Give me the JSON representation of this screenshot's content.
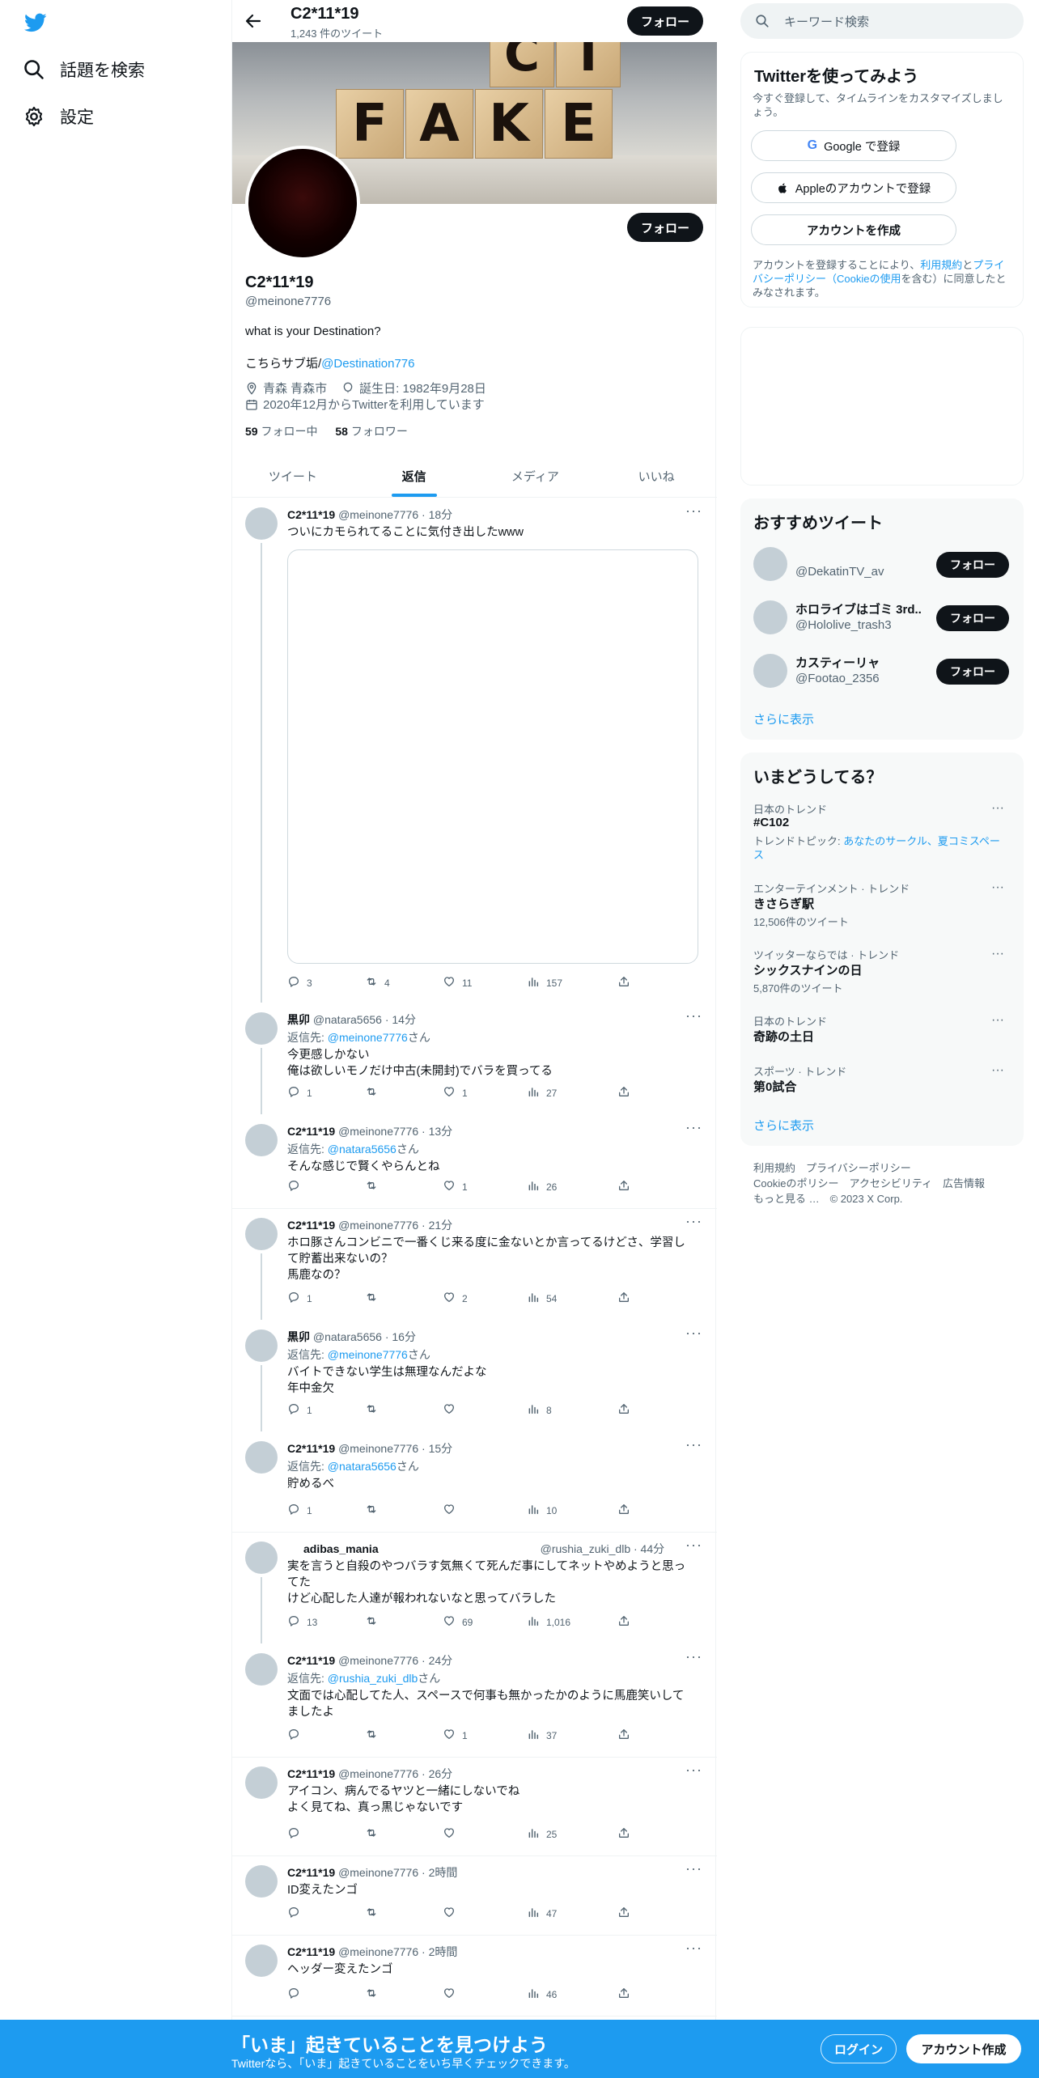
{
  "nav": {
    "explore_label": "話題を検索",
    "settings_label": "設定"
  },
  "header": {
    "title": "C2*11*19",
    "tweet_count": "1,243 件のツイート",
    "follow_label": "フォロー"
  },
  "banner": {
    "letters": [
      "F",
      "A",
      "K",
      "E",
      "C",
      "T"
    ]
  },
  "profile": {
    "name": "C2*11*19",
    "handle": "@meinone7776",
    "bio": "what is your Destination?",
    "bio2_prefix": "こちらサブ垢/",
    "bio2_link": "@Destination776",
    "location": "青森 青森市",
    "birthday": "誕生日: 1982年9月28日",
    "joined": "2020年12月からTwitterを利用しています",
    "following_count": "59",
    "following_label": "フォロー中",
    "followers_count": "58",
    "followers_label": "フォロワー",
    "follow_label": "フォロー"
  },
  "tabs": [
    "ツイート",
    "返信",
    "メディア",
    "いいね"
  ],
  "tweets": [
    {
      "name": "C2*11*19",
      "meta": "@meinone7776 · 18分",
      "reply_to": "",
      "text": "ついにカモられてることに気付き出したwww",
      "replies": "3",
      "retweets": "4",
      "likes": "11",
      "views": "157"
    },
    {
      "name": "黒卯",
      "meta": "@natara5656 · 14分",
      "reply_to": "@meinone7776",
      "text": "今更感しかない\n俺は欲しいモノだけ中古(未開封)でバラを買ってる",
      "replies": "1",
      "retweets": "",
      "likes": "1",
      "views": "27"
    },
    {
      "name": "C2*11*19",
      "meta": "@meinone7776 · 13分",
      "reply_to": "@natara5656",
      "text": "そんな感じで賢くやらんとね",
      "replies": "",
      "retweets": "",
      "likes": "1",
      "views": "26"
    },
    {
      "name": "C2*11*19",
      "meta": "@meinone7776 · 21分",
      "reply_to": "",
      "text": "ホロ豚さんコンビニで一番くじ来る度に金ないとか言ってるけどさ、学習して貯蓄出来ないの？\n馬鹿なの？",
      "replies": "1",
      "retweets": "",
      "likes": "2",
      "views": "54"
    },
    {
      "name": "黒卯",
      "meta": "@natara5656 · 16分",
      "reply_to": "@meinone7776",
      "text": "バイトできない学生は無理なんだよな\n年中金欠",
      "replies": "1",
      "retweets": "",
      "likes": "",
      "views": "8"
    },
    {
      "name": "C2*11*19",
      "meta": "@meinone7776 · 15分",
      "reply_to": "@natara5656",
      "text": "貯めるべ",
      "replies": "1",
      "retweets": "",
      "likes": "",
      "views": "10"
    },
    {
      "name": "adibas_mania",
      "meta": "@rushia_zuki_dlb · 44分",
      "reply_to": "",
      "text": "実を言うと自殺のやつバラす気無くて死んだ事にしてネットやめようと思ってた\nけど心配した人達が報われないなと思ってバラした",
      "replies": "13",
      "retweets": "",
      "likes": "69",
      "views": "1,016"
    },
    {
      "name": "C2*11*19",
      "meta": "@meinone7776 · 24分",
      "reply_to": "@rushia_zuki_dlb",
      "text": "文面では心配してた人、スペースで何事も無かったかのように馬鹿笑いしてましたよ",
      "replies": "",
      "retweets": "",
      "likes": "1",
      "views": "37"
    },
    {
      "name": "C2*11*19",
      "meta": "@meinone7776 · 26分",
      "reply_to": "",
      "text": "アイコン、病んでるヤツと一緒にしないでね\nよく見てね、真っ黒じゃないです",
      "replies": "",
      "retweets": "",
      "likes": "",
      "views": "25"
    },
    {
      "name": "C2*11*19",
      "meta": "@meinone7776 · 2時間",
      "reply_to": "",
      "text": "ID変えたンゴ",
      "replies": "",
      "retweets": "",
      "likes": "",
      "views": "47"
    },
    {
      "name": "C2*11*19",
      "meta": "@meinone7776 · 2時間",
      "reply_to": "",
      "text": "ヘッダー変えたンゴ",
      "replies": "",
      "retweets": "",
      "likes": "",
      "views": "46"
    }
  ],
  "reply_prefix": "返信先: ",
  "reply_suffix": "さん",
  "right": {
    "search_placeholder": "キーワード検索",
    "signup_title": "Twitterを使ってみよう",
    "signup_desc": "今すぐ登録して、タイムラインをカスタマイズしましょう。",
    "google_btn": "Google で登録",
    "apple_btn": "Appleのアカウントで登録",
    "create_btn": "アカウントを作成",
    "terms_1": "アカウントを登録することにより、",
    "terms_link1": "利用規約",
    "terms_2": "と",
    "terms_link2": "プライバシーポリシー",
    "terms_3": "（",
    "terms_link3": "Cookieの使用",
    "terms_4": "を含む）に同意したとみなされます。",
    "rec_title": "おすすめツイート",
    "recs": [
      {
        "name": "",
        "handle": "@DekatinTV_av",
        "btn": "フォロー"
      },
      {
        "name": "ホロライブはゴミ 3rd...",
        "handle": "@Hololive_trash3",
        "btn": "フォロー"
      },
      {
        "name": "カスティーリャ",
        "handle": "@Footao_2356",
        "btn": "フォロー"
      }
    ],
    "show_more": "さらに表示",
    "trends_title": "いまどうしてる？",
    "trends": [
      {
        "cat": "日本のトレンド",
        "name": "#C102",
        "extra_prefix": "トレンドトピック: ",
        "extra_link": "あなたのサークル、夏コミスペース",
        "count": ""
      },
      {
        "cat": "エンターテインメント · トレンド",
        "name": "きさらぎ駅",
        "extra_prefix": "",
        "extra_link": "",
        "count": "12,506件のツイート"
      },
      {
        "cat": "ツイッターならでは · トレンド",
        "name": "シックスナインの日",
        "extra_prefix": "",
        "extra_link": "",
        "count": "5,870件のツイート"
      },
      {
        "cat": "日本のトレンド",
        "name": "奇跡の土日",
        "extra_prefix": "",
        "extra_link": "",
        "count": ""
      },
      {
        "cat": "スポーツ · トレンド",
        "name": "第0試合",
        "extra_prefix": "",
        "extra_link": "",
        "count": ""
      }
    ],
    "trends_more": "さらに表示",
    "footer_line1": "利用規約　プライバシーポリシー",
    "footer_line2": "Cookieのポリシー　アクセシビリティ　広告情報",
    "footer_line3": "もっと見る …　© 2023 X Corp."
  },
  "bottom": {
    "title": "「いま」起きていることを見つけよう",
    "subtitle": "Twitterなら、「いま」起きていることをいち早くチェックできます。",
    "login": "ログイン",
    "signup": "アカウント作成"
  },
  "colors": {
    "accent": "#1d9bf0",
    "text": "#0f1419",
    "muted": "#536471"
  }
}
